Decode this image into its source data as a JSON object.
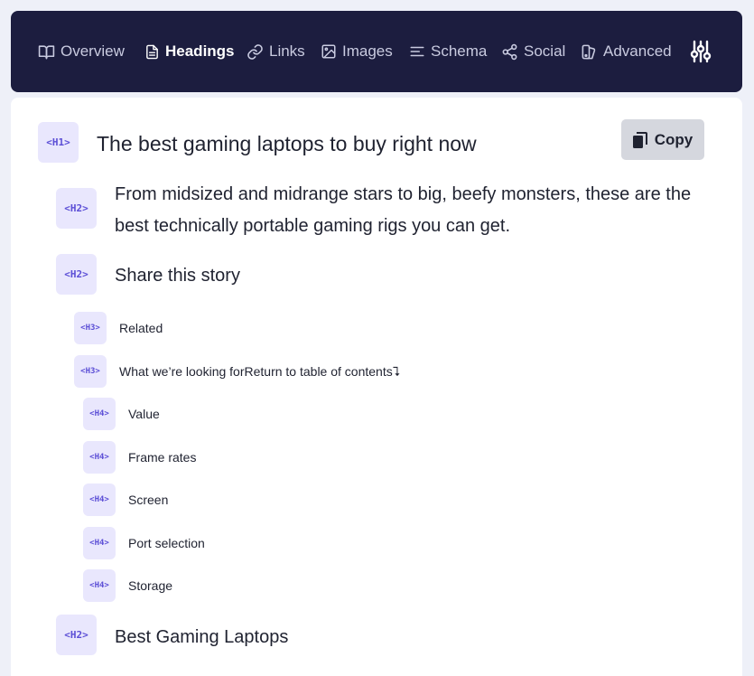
{
  "nav": {
    "items": [
      {
        "label": "Overview",
        "icon": "book-icon",
        "active": false
      },
      {
        "label": "Headings",
        "icon": "document-icon",
        "active": true
      },
      {
        "label": "Links",
        "icon": "link-icon",
        "active": false
      },
      {
        "label": "Images",
        "icon": "image-icon",
        "active": false
      },
      {
        "label": "Schema",
        "icon": "text-lines-icon",
        "active": false
      },
      {
        "label": "Social",
        "icon": "share-icon",
        "active": false
      },
      {
        "label": "Advanced",
        "icon": "advanced-icon",
        "active": false
      }
    ],
    "settings_icon": "sliders-icon"
  },
  "copy_button": {
    "label": "Copy",
    "icon": "copy-icon"
  },
  "headings": [
    {
      "level": "<H1>",
      "text": "The best gaming laptops to buy right now"
    },
    {
      "level": "<H2>",
      "text": "From midsized and midrange stars to big, beefy monsters, these are the best technically portable gaming rigs you can get."
    },
    {
      "level": "<H2>",
      "text": "Share this story"
    },
    {
      "level": "<H3>",
      "text": "Related"
    },
    {
      "level": "<H3>",
      "text": "What we’re looking forReturn to table of contents⮧"
    },
    {
      "level": "<H4>",
      "text": "Value"
    },
    {
      "level": "<H4>",
      "text": "Frame rates"
    },
    {
      "level": "<H4>",
      "text": "Screen"
    },
    {
      "level": "<H4>",
      "text": "Port selection"
    },
    {
      "level": "<H4>",
      "text": "Storage"
    },
    {
      "level": "<H2>",
      "text": "Best Gaming Laptops"
    }
  ],
  "colors": {
    "nav_background": "#1c1d3f",
    "badge_background": "#e9e7fd",
    "badge_text": "#5b4ed6",
    "page_background": "#eef0f8"
  }
}
